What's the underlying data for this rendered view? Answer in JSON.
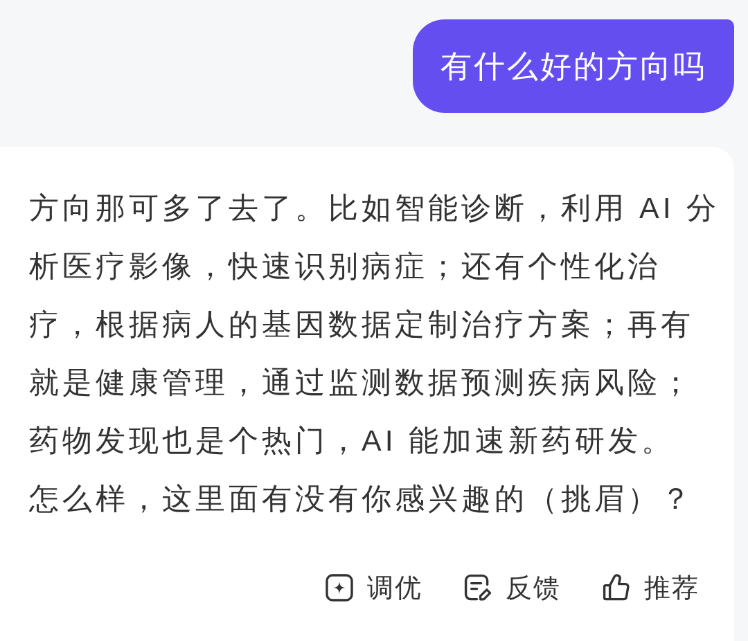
{
  "user_message": {
    "text": "有什么好的方向吗"
  },
  "reply": {
    "paragraphs": [
      "方向那可多了去了。比如智能诊断，利用 AI 分析医疗影像，快速识别病症；还有个性化治疗，根据病人的基因数据定制治疗方案；再有就是健康管理，通过监测数据预测疾病风险；药物发现也是个热门，AI 能加速新药研发。",
      "怎么样，这里面有没有你感兴趣的（挑眉）？"
    ],
    "actions": [
      {
        "kind": "tune",
        "label": "调优"
      },
      {
        "kind": "feedback",
        "label": "反馈"
      },
      {
        "kind": "recommend",
        "label": "推荐"
      }
    ]
  }
}
